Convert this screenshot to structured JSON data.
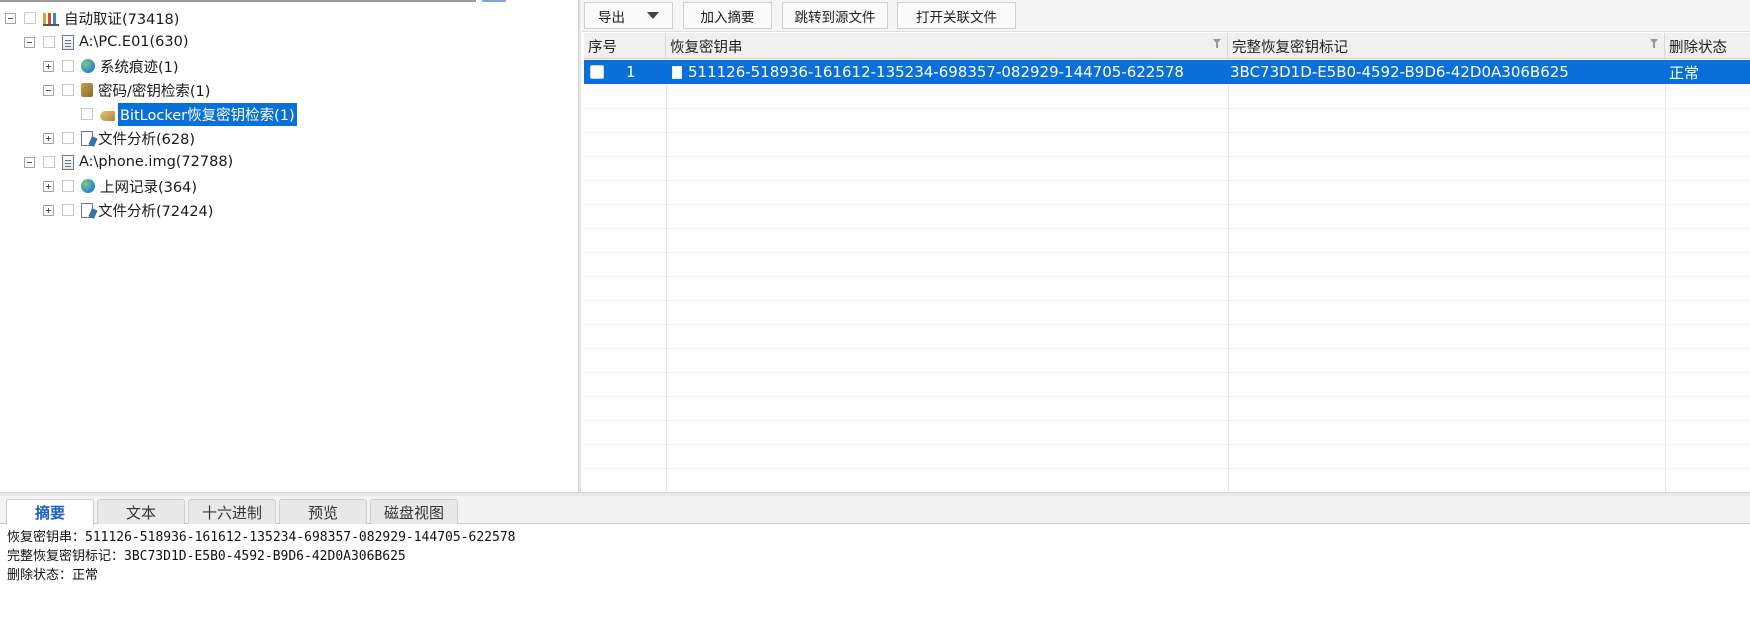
{
  "tree": {
    "nodes": [
      {
        "label": "自动取证(73418)",
        "icon": "evidence-bars-icon",
        "expanded": true
      },
      {
        "label": "A:\\PC.E01(630)",
        "icon": "disk-image-icon",
        "expanded": true
      },
      {
        "label": "系统痕迹(1)",
        "icon": "globe-icon",
        "expanded": false
      },
      {
        "label": "密码/密钥检索(1)",
        "icon": "key-icon",
        "expanded": true
      },
      {
        "label": "BitLocker恢复密钥检索(1)",
        "icon": "bitlocker-key-icon",
        "selected": true
      },
      {
        "label": "文件分析(628)",
        "icon": "file-analysis-icon",
        "expanded": false
      },
      {
        "label": "A:\\phone.img(72788)",
        "icon": "disk-image-icon",
        "expanded": true
      },
      {
        "label": "上网记录(364)",
        "icon": "globe-icon",
        "expanded": false
      },
      {
        "label": "文件分析(72424)",
        "icon": "file-analysis-icon",
        "expanded": false
      }
    ]
  },
  "toolbar": {
    "export_label": "导出",
    "add_summary_label": "加入摘要",
    "goto_source_label": "跳转到源文件",
    "open_related_label": "打开关联文件"
  },
  "grid": {
    "columns": [
      "序号",
      "恢复密钥串",
      "完整恢复密钥标记",
      "删除状态"
    ],
    "rows": [
      {
        "index": "1",
        "recovery_key": "511126-518936-161612-135234-698357-082929-144705-622578",
        "key_id": "3BC73D1D-E5B0-4592-B9D6-42D0A306B625",
        "status": "正常",
        "selected": true
      }
    ]
  },
  "tabs": [
    "摘要",
    "文本",
    "十六进制",
    "预览",
    "磁盘视图"
  ],
  "active_tab": "摘要",
  "summary": {
    "lines": [
      "恢复密钥串：511126-518936-161612-135234-698357-082929-144705-622578",
      "完整恢复密钥标记：3BC73D1D-E5B0-4592-B9D6-42D0A306B625",
      "删除状态：正常"
    ]
  },
  "colors": {
    "selection": "#0a6fd8",
    "active_tab_text": "#1a5fc4"
  }
}
